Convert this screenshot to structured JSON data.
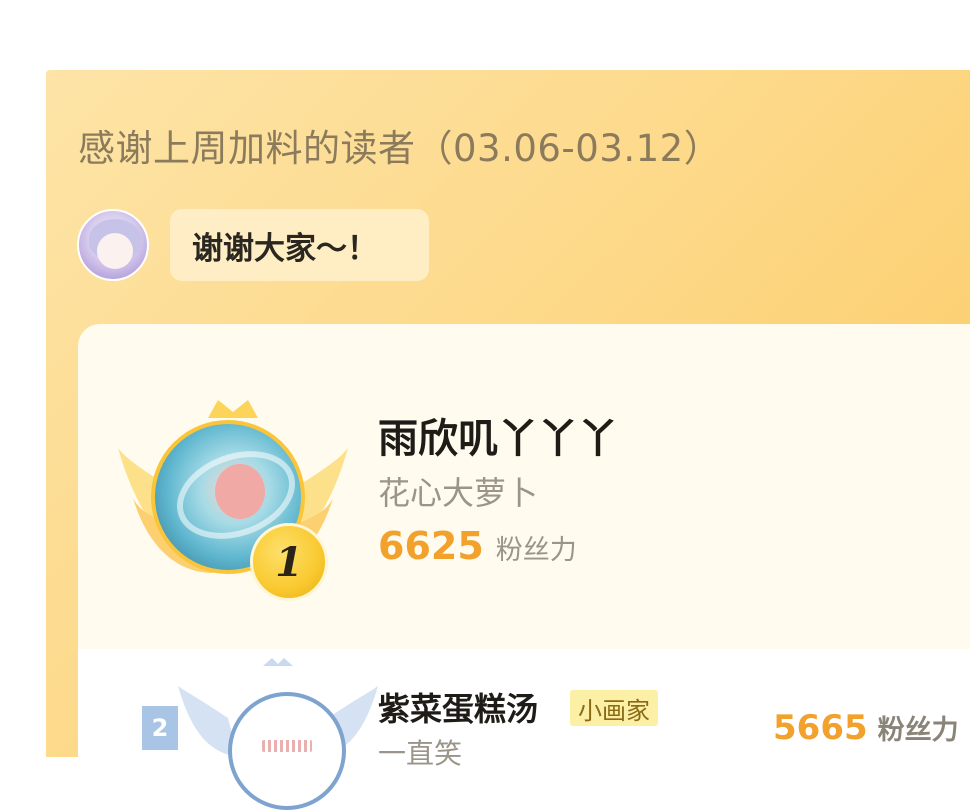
{
  "header": {
    "title": "感谢上周加料的读者（03.06-03.12）"
  },
  "host": {
    "avatar_icon": "author-avatar-icon",
    "message": "谢谢大家～！"
  },
  "leaderboard": {
    "first": {
      "rank": "1",
      "name": "雨欣叽丫丫丫",
      "subtitle": "花心大萝卜",
      "score": "6625",
      "score_unit": "粉丝力",
      "medal_color": "#fbc53a"
    },
    "second": {
      "rank": "2",
      "name": "紫菜蛋糕汤",
      "tag": "小画家",
      "subtitle": "一直笑",
      "score": "5665",
      "score_unit": "粉丝力",
      "medal_color": "#7ea3cf"
    }
  },
  "colors": {
    "accent": "#f1a12c",
    "panel_bg": "#fdd98a"
  }
}
